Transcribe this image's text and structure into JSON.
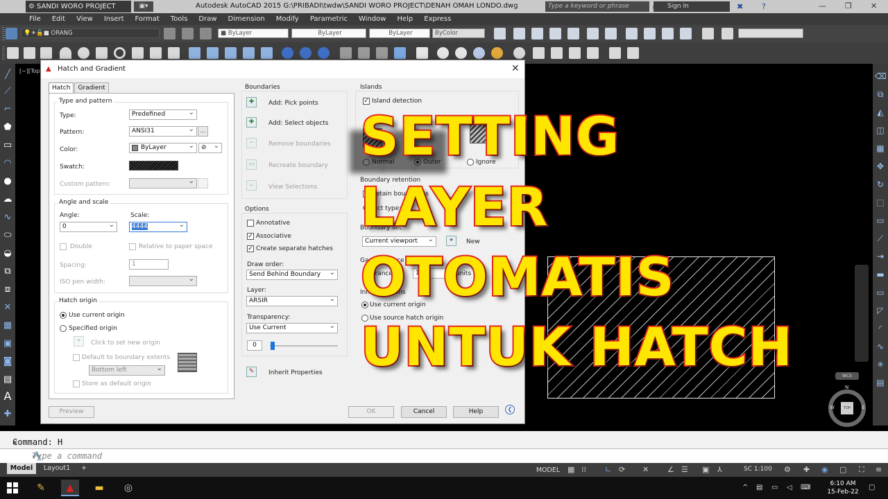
{
  "titlebar": {
    "workspace": "SANDI WORO PROJECT",
    "title": "Autodesk AutoCAD 2015    G:\\PRIBADI\\twdw\\SANDI WORO PROJECT\\DENAH OMAH LONDO.dwg",
    "search_placeholder": "Type a keyword or phrase",
    "sign_in": "Sign In"
  },
  "menu": [
    "File",
    "Edit",
    "View",
    "Insert",
    "Format",
    "Tools",
    "Draw",
    "Dimension",
    "Modify",
    "Parametric",
    "Window",
    "Help",
    "Express"
  ],
  "toolbar": {
    "layer_value": "ORANG",
    "color_value": "ByLayer",
    "linetype_value": "ByLayer",
    "lineweight_value": "ByLayer",
    "plotstyle_value": "ByColor"
  },
  "viewport_label": "[−][Top",
  "dialog": {
    "title": "Hatch and Gradient",
    "close": "✕",
    "tabs": [
      "Hatch",
      "Gradient"
    ],
    "type_pattern": {
      "group": "Type and pattern",
      "type_label": "Type:",
      "type_value": "Predefined",
      "pattern_label": "Pattern:",
      "pattern_value": "ANSI31",
      "color_label": "Color:",
      "color_value": "ByLayer",
      "swatch_label": "Swatch:",
      "custom_label": "Custom pattern:"
    },
    "angle_scale": {
      "group": "Angle and scale",
      "angle_label": "Angle:",
      "angle_value": "0",
      "scale_label": "Scale:",
      "scale_value": "4444",
      "double_label": "Double",
      "relative_label": "Relative to paper space",
      "spacing_label": "Spacing:",
      "spacing_value": "1",
      "iso_label": "ISO pen width:"
    },
    "origin": {
      "group": "Hatch origin",
      "use_current": "Use current origin",
      "specified": "Specified origin",
      "click_set": "Click to set new origin",
      "default_extents": "Default to boundary extents",
      "position": "Bottom left",
      "store_default": "Store as default origin"
    },
    "boundaries": {
      "group": "Boundaries",
      "pick_points": "Add: Pick points",
      "select_objects": "Add: Select objects",
      "remove": "Remove boundaries",
      "recreate": "Recreate boundary",
      "view_selections": "View Selections"
    },
    "options": {
      "group": "Options",
      "annotative": "Annotative",
      "associative": "Associative",
      "separate": "Create separate hatches",
      "draw_order_label": "Draw order:",
      "draw_order_value": "Send Behind Boundary",
      "layer_label": "Layer:",
      "layer_value": "ARSIR",
      "transparency_label": "Transparency:",
      "transparency_value": "Use Current",
      "transparency_amount": "0"
    },
    "inherit": "Inherit Properties",
    "islands": {
      "group": "Islands",
      "detection": "Island detection",
      "normal": "Normal",
      "outer": "Outer",
      "ignore": "Ignore"
    },
    "boundary_retention": {
      "group": "Boundary retention",
      "retain": "Retain boundaries",
      "object_type": "Object type:"
    },
    "boundary_set": {
      "group": "Boundary set",
      "value": "Current viewport",
      "new": "New"
    },
    "gap": {
      "group": "Gap tolerance",
      "tolerance": "Tolerance:",
      "value": "10",
      "units": "units"
    },
    "inherit_options": {
      "group": "Inherit options",
      "use_current": "Use current origin",
      "use_source": "Use source hatch origin"
    },
    "buttons": {
      "preview": "Preview",
      "ok": "OK",
      "cancel": "Cancel",
      "help": "Help"
    }
  },
  "overlay": [
    "SETTING",
    "LAYER",
    "OTOMATIS",
    "UNTUK HATCH"
  ],
  "compass": {
    "n": "N",
    "w": "W",
    "e": "E",
    "s": "S",
    "top": "TOP"
  },
  "wcs": "WCS",
  "command": {
    "history": "Command: H",
    "placeholder": "Type a command"
  },
  "status": {
    "tab_model": "Model",
    "tab_layout": "Layout1",
    "add": "+",
    "model": "MODEL",
    "scale": "SC 1:100"
  },
  "taskbar": {
    "time": "6:10 AM",
    "date": "15-Feb-22"
  }
}
